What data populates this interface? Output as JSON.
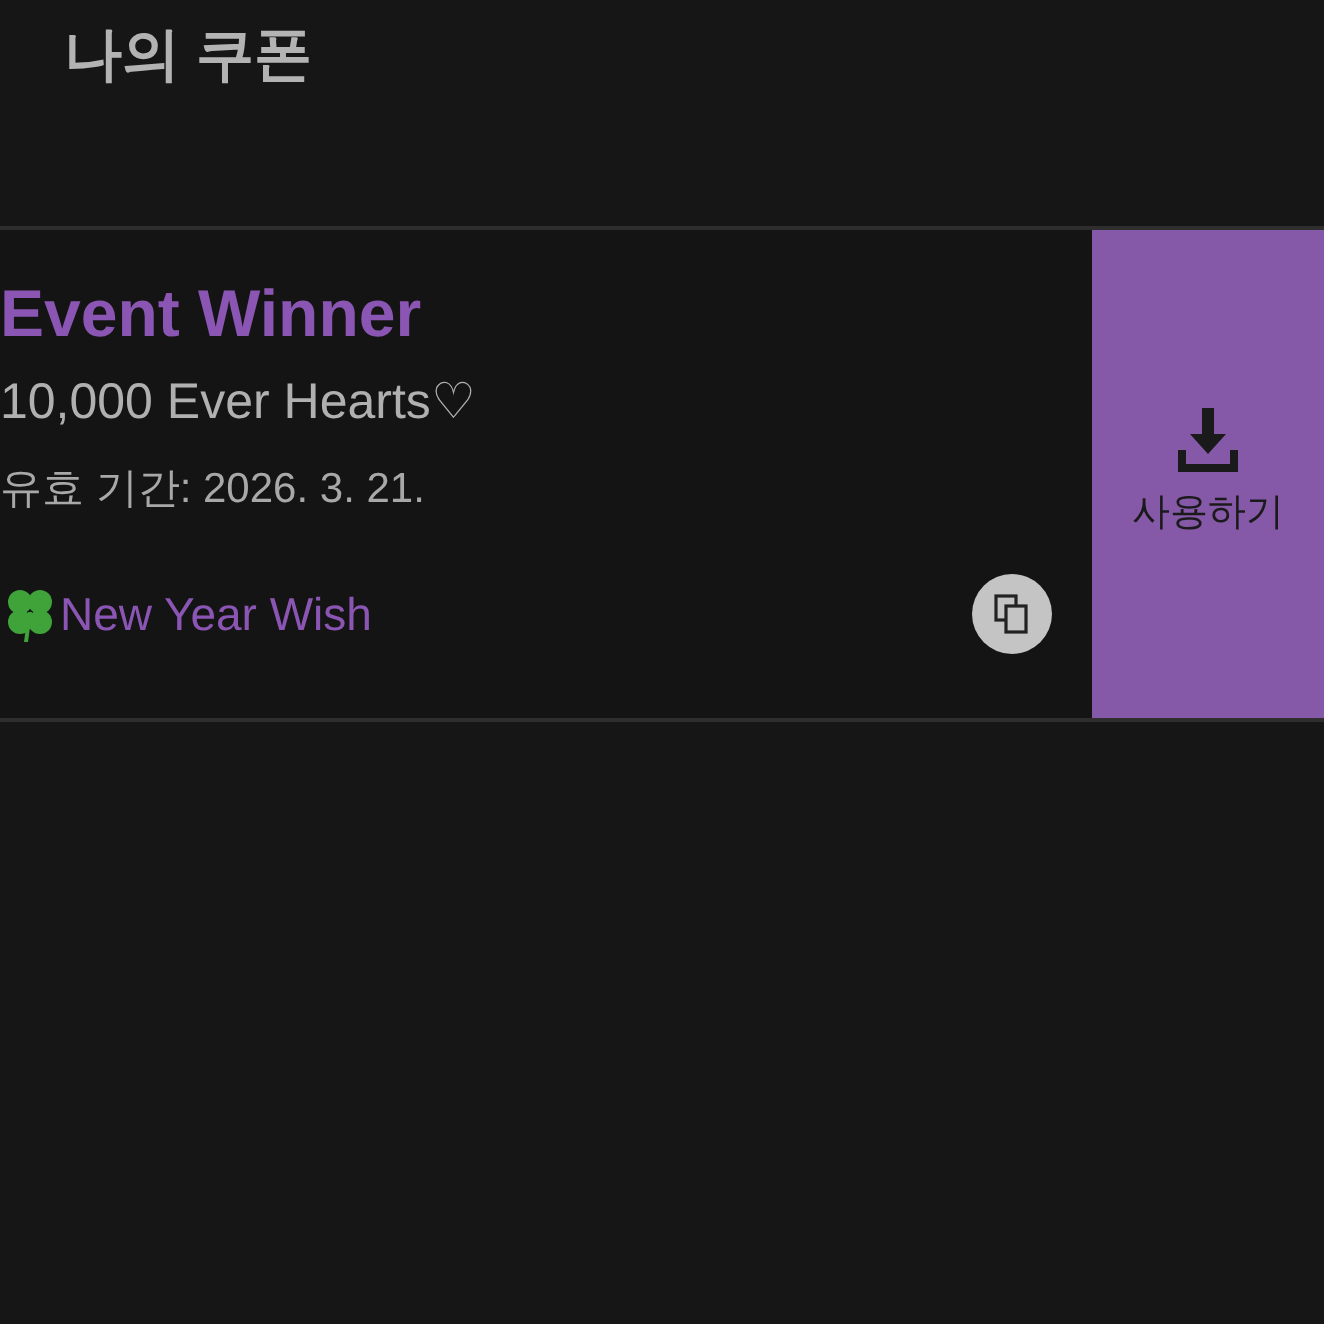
{
  "header": {
    "title": "나의 쿠폰"
  },
  "coupons": [
    {
      "title": "Event Winner",
      "reward": "10,000 Ever Hearts♡",
      "validity": "유효 기간: 2026. 3. 21.",
      "tag": "New Year Wish",
      "action": "사용하기"
    }
  ]
}
